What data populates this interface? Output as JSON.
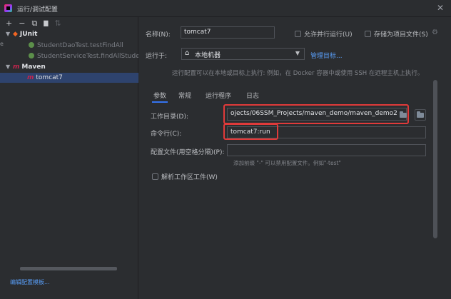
{
  "window": {
    "title": "运行/调试配置",
    "close_glyph": "✕"
  },
  "toolbar": {
    "add": "+",
    "remove": "−",
    "copy": "⧉",
    "folder": "▇",
    "sort": "⇅"
  },
  "tree": {
    "junit": {
      "label": "JUnit"
    },
    "junit_items": [
      {
        "label": "StudentDaoTest.testFindAll"
      },
      {
        "label": "StudentServiceTest.findAllStude"
      }
    ],
    "maven": {
      "label": "Maven"
    },
    "maven_items": [
      {
        "label": "tomcat7"
      }
    ],
    "edit_templates": "编辑配置模板..."
  },
  "form": {
    "name_label": "名称(N):",
    "name_value": "tomcat7",
    "allow_parallel": "允许并行运行(U)",
    "store_as_project": "存储为项目文件(S)",
    "run_on_label": "运行于:",
    "run_on_value": "本地机器",
    "manage_targets": "管理目标...",
    "run_on_hint": "运行配置可以在本地或目标上执行: 例如，在 Docker 容器中或使用 SSH 在远程主机上执行。",
    "working_dir_label": "工作目录(D):",
    "working_dir_value": "ojects/06SSM_Projects/maven_demo/maven_demo2",
    "command_label": "命令行(C):",
    "command_value": "tomcat7:run",
    "profiles_label": "配置文件(用空格分隔)(P):",
    "profiles_value": "",
    "profiles_hint": "添加前缀 \"-\" 可以禁用配置文件。例如\"-test\"",
    "resolve_workspace": "解析工作区工件(W)"
  },
  "tabs": [
    {
      "label": "参数"
    },
    {
      "label": "常规"
    },
    {
      "label": "运行程序"
    },
    {
      "label": "日志"
    }
  ],
  "colors": {
    "accent": "#3574f0",
    "highlight": "#e03a3a",
    "selection": "#2e436e"
  }
}
